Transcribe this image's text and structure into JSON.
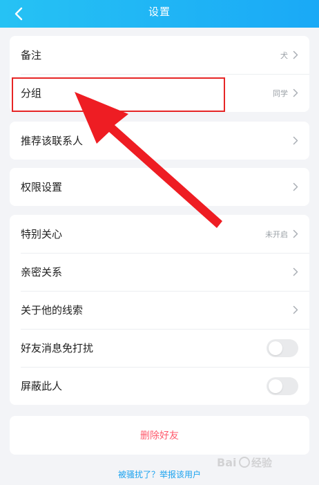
{
  "header": {
    "title": "设置"
  },
  "card1": {
    "rows": [
      {
        "label": "备注",
        "value": "犬"
      },
      {
        "label": "分组",
        "value": "同学"
      }
    ]
  },
  "card2": {
    "rows": [
      {
        "label": "推荐该联系人"
      }
    ]
  },
  "card3": {
    "rows": [
      {
        "label": "权限设置"
      }
    ]
  },
  "card4": {
    "rows": [
      {
        "label": "特别关心",
        "value": "未开启"
      },
      {
        "label": "亲密关系"
      },
      {
        "label": "关于他的线索"
      },
      {
        "label": "好友消息免打扰",
        "toggle_on": false
      },
      {
        "label": "屏蔽此人",
        "toggle_on": false
      }
    ]
  },
  "delete_button": {
    "label": "删除好友"
  },
  "footer": {
    "report_link": "被骚扰了？举报该用户"
  },
  "colors": {
    "header_start": "#26c2f4",
    "header_end": "#1aa9f6",
    "background": "#f3f4f7",
    "danger_text": "#ff5b6d",
    "link_text": "#1aa2ef",
    "annotation_red": "#e62525"
  }
}
